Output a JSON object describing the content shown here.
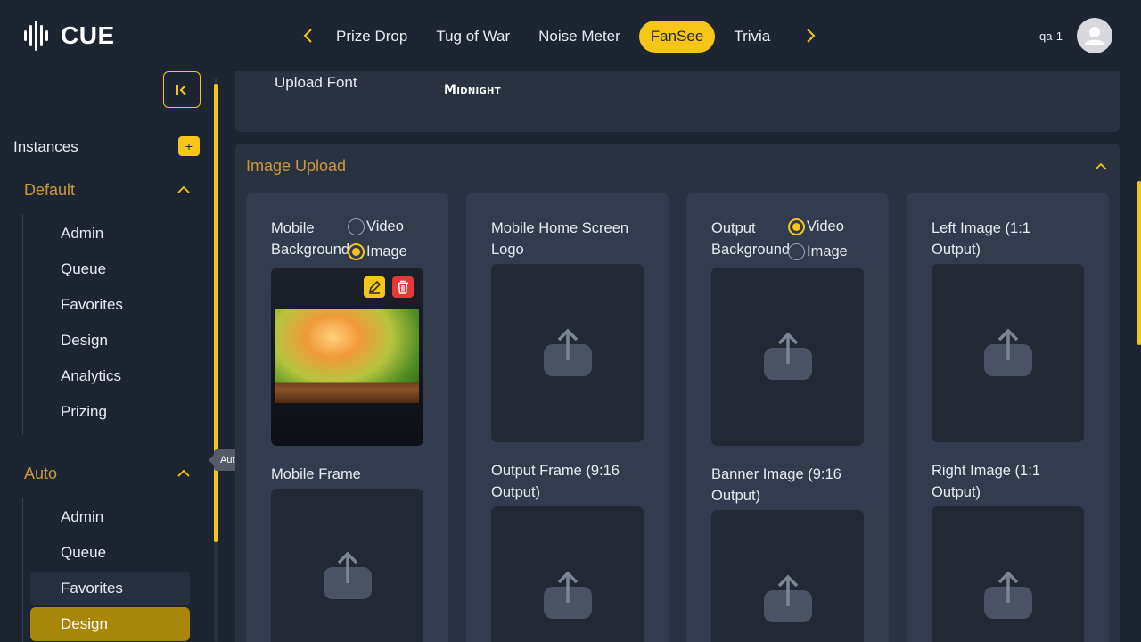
{
  "app": {
    "logo_text": "CUE"
  },
  "nav": {
    "tabs": [
      {
        "label": "Prize Drop"
      },
      {
        "label": "Tug of War"
      },
      {
        "label": "Noise Meter"
      },
      {
        "label": "FanSee",
        "active": true
      },
      {
        "label": "Trivia"
      }
    ]
  },
  "user": {
    "name": "qa-1"
  },
  "sidebar": {
    "instances_label": "Instances",
    "add_label": "+",
    "groups": [
      {
        "title": "Default",
        "items": [
          "Admin",
          "Queue",
          "Favorites",
          "Design",
          "Analytics",
          "Prizing"
        ]
      },
      {
        "title": "Auto",
        "items": [
          "Admin",
          "Queue",
          "Favorites",
          "Design"
        ],
        "hovered": "Favorites",
        "active": "Design"
      }
    ],
    "tooltip": "Auto"
  },
  "font_section": {
    "label": "Upload Font",
    "preview": "Midnight"
  },
  "image_section": {
    "title": "Image Upload",
    "cards": [
      {
        "label": "Mobile Background",
        "options": [
          "Video",
          "Image"
        ],
        "selected": "Image",
        "has_image": true,
        "bottom_label": "Mobile Frame"
      },
      {
        "label": "Mobile Home Screen Logo",
        "bottom_label": "Output Frame (9:16 Output)"
      },
      {
        "label": "Output Background",
        "options": [
          "Video",
          "Image"
        ],
        "selected": "Video",
        "bottom_label": "Banner Image (9:16 Output)"
      },
      {
        "label": "Left Image (1:1 Output)",
        "bottom_label": "Right Image (1:1 Output)"
      }
    ]
  },
  "colors": {
    "accent": "#f5c518",
    "background": "#1e2532",
    "panel": "#2a3242",
    "card": "#323c4e",
    "section_title": "#c9993a",
    "danger": "#e53935"
  }
}
